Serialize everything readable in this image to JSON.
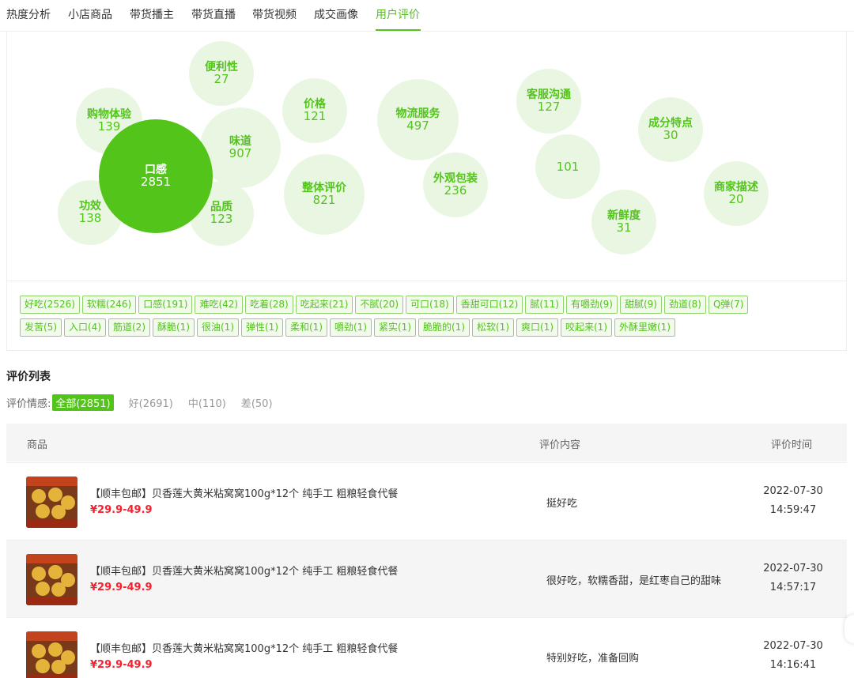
{
  "tabs": [
    {
      "label": "热度分析"
    },
    {
      "label": "小店商品"
    },
    {
      "label": "带货播主"
    },
    {
      "label": "带货直播"
    },
    {
      "label": "带货视频"
    },
    {
      "label": "成交画像"
    },
    {
      "label": "用户评价"
    }
  ],
  "bubbles": [
    {
      "label": "便利性",
      "value": "27"
    },
    {
      "label": "购物体验",
      "value": "139"
    },
    {
      "label": "价格",
      "value": "121"
    },
    {
      "label": "物流服务",
      "value": "497"
    },
    {
      "label": "客服沟通",
      "value": "127"
    },
    {
      "label": "成分特点",
      "value": "30"
    },
    {
      "label": "味道",
      "value": "907"
    },
    {
      "label": "口感",
      "value": "2851"
    },
    {
      "label": "外观包装",
      "value": "236"
    },
    {
      "label": "",
      "value": "101"
    },
    {
      "label": "整体评价",
      "value": "821"
    },
    {
      "label": "商家描述",
      "value": "20"
    },
    {
      "label": "功效",
      "value": "138"
    },
    {
      "label": "品质",
      "value": "123"
    },
    {
      "label": "新鲜度",
      "value": "31"
    }
  ],
  "tags": [
    "好吃(2526)",
    "软糯(246)",
    "口感(191)",
    "难吃(42)",
    "吃着(28)",
    "吃起来(21)",
    "不腻(20)",
    "可口(18)",
    "香甜可口(12)",
    "腻(11)",
    "有嚼劲(9)",
    "甜腻(9)",
    "劲道(8)",
    "Q弹(7)",
    "发苦(5)",
    "入口(4)",
    "筋道(2)",
    "酥脆(1)",
    "很油(1)",
    "弹性(1)",
    "柔和(1)",
    "嚼劲(1)",
    "紧实(1)",
    "脆脆的(1)",
    "松软(1)",
    "爽口(1)",
    "咬起来(1)",
    "外酥里嫩(1)"
  ],
  "list": {
    "title": "评价列表",
    "sentiment_label": "评价情感:",
    "options": [
      "全部(2851)",
      "好(2691)",
      "中(110)",
      "差(50)"
    ],
    "columns": [
      "商品",
      "评价内容",
      "评价时间"
    ],
    "rows": [
      {
        "product": "【顺丰包邮】贝香莲大黄米粘窝窝100g*12个 纯手工 粗粮轻食代餐",
        "price": "¥29.9-49.9",
        "comment": "挺好吃",
        "date": "2022-07-30",
        "time": "14:59:47"
      },
      {
        "product": "【顺丰包邮】贝香莲大黄米粘窝窝100g*12个 纯手工 粗粮轻食代餐",
        "price": "¥29.9-49.9",
        "comment": "很好吃，软糯香甜，是红枣自己的甜味",
        "date": "2022-07-30",
        "time": "14:57:17"
      },
      {
        "product": "【顺丰包邮】贝香莲大黄米粘窝窝100g*12个 纯手工 粗粮轻食代餐",
        "price": "¥29.9-49.9",
        "comment": "特别好吃，准备回购",
        "date": "2022-07-30",
        "time": "14:16:41"
      }
    ]
  },
  "colors": {
    "accent": "#52c41a",
    "bubble_bg": "#e9f7e2",
    "price": "#f5222d"
  }
}
